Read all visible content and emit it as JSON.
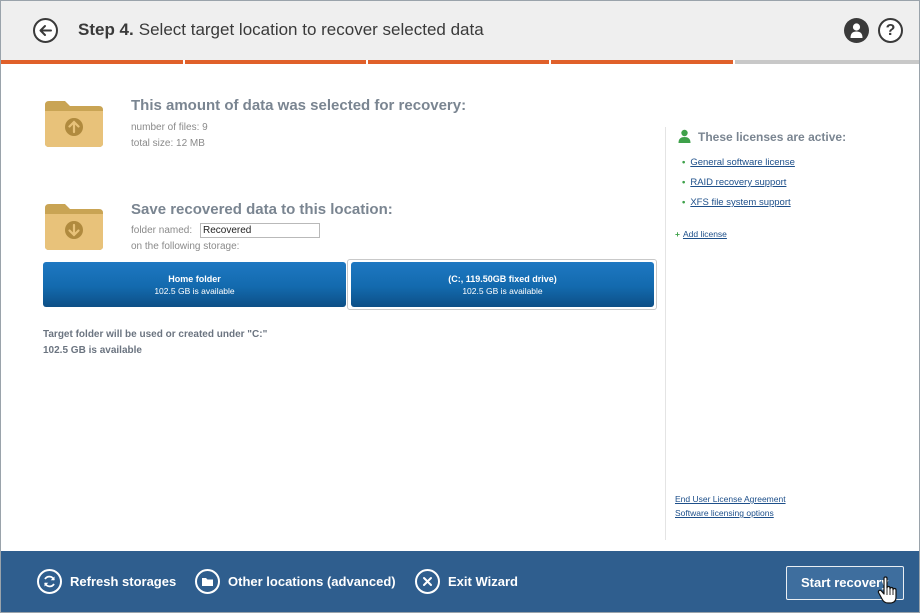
{
  "header": {
    "step_label": "Step 4.",
    "title": "Select target location to recover selected data",
    "back_icon": "back-arrow-icon",
    "user_icon": "user-icon",
    "help_glyph": "?"
  },
  "progress": {
    "completed_fraction": 0.8,
    "segments": 5,
    "accent": "#e0602a"
  },
  "selection": {
    "heading": "This amount of data was selected for recovery:",
    "files_label": "number of files: 9",
    "size_label": "total size: 12 MB"
  },
  "save": {
    "heading": "Save recovered data to this location:",
    "folder_label": "folder named:",
    "folder_value": "Recovered",
    "storage_label": "on the following storage:"
  },
  "storages": [
    {
      "name": "Home folder",
      "available": "102.5 GB is available"
    },
    {
      "name": "(C:, 119.50GB fixed drive)",
      "available": "102.5 GB is available"
    }
  ],
  "target": {
    "line1": "Target folder will be used or created under \"C:\"",
    "line2": "102.5 GB is available"
  },
  "licenses": {
    "heading": "These licenses are active:",
    "items": [
      "General software license",
      "RAID recovery support",
      "XFS file system support"
    ],
    "add_label": "Add license",
    "eula": "End User License Agreement",
    "options": "Software licensing options"
  },
  "footer": {
    "refresh": "Refresh storages",
    "other": "Other locations (advanced)",
    "exit": "Exit Wizard",
    "start": "Start recovery"
  },
  "colors": {
    "bottom_bar": "#2f5e8e",
    "storage_button": "#136aae",
    "link": "#1d4f8a",
    "bullet": "#3ea14a"
  }
}
